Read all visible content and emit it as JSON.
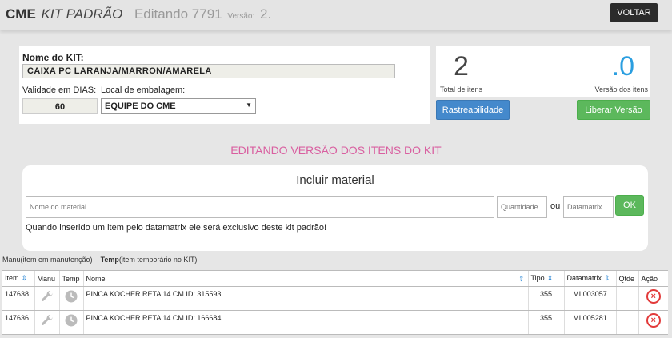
{
  "header": {
    "brand_cme": "CME",
    "brand_kit": "KIT PADRÃO",
    "editing_label": "Editando 7791",
    "version_label": "Versão:",
    "version_value": "2.",
    "back_button": "VOLTAR"
  },
  "kit": {
    "name_label": "Nome do KIT:",
    "name_value": "CAIXA PC LARANJA/MARRON/AMARELA",
    "validity_label": "Validade em DIAS:",
    "validity_value": "60",
    "location_label": "Local de embalagem:",
    "location_value": "EQUIPE DO CME"
  },
  "stats": {
    "total_items": "2",
    "total_items_label": "Total de itens",
    "version_items": ".0",
    "version_items_label": "Versão dos itens",
    "rastreabilidade_button": "Rastreabilidade",
    "liberar_button": "Liberar Versão"
  },
  "section_title": "EDITANDO VERSÃO DOS ITENS DO KIT",
  "incluir": {
    "title": "Incluir material",
    "material_placeholder": "Nome do material",
    "quantity_placeholder": "Quantidade",
    "ou_label": "ou",
    "datamatrix_placeholder": "Datamatrix",
    "ok_button": "OK",
    "note": "Quando inserido um item pelo datamatrix ele será exclusivo deste kit padrão!"
  },
  "legend": {
    "manu": "Manu(item em manutenção)",
    "temp_bold": "Temp",
    "temp_rest": "(item temporário no KIT)"
  },
  "table": {
    "headers": {
      "item": "Item",
      "manu": "Manu",
      "temp": "Temp",
      "nome": "Nome",
      "tipo": "Tipo",
      "datamatrix": "Datamatrix",
      "qtde": "Qtde",
      "acao": "Ação"
    },
    "rows": [
      {
        "item": "147638",
        "nome": "PINCA KOCHER RETA 14 CM ID: 315593",
        "tipo": "355",
        "datamatrix": "ML003057",
        "qtde": ""
      },
      {
        "item": "147636",
        "nome": "PINCA KOCHER RETA 14 CM ID: 166684",
        "tipo": "355",
        "datamatrix": "ML005281",
        "qtde": ""
      }
    ]
  },
  "icons": {
    "sort": "sort-arrows-icon",
    "manutencao": "wrench-icon",
    "temporario": "clock-icon",
    "remover": "remove-circle-icon"
  },
  "colors": {
    "accent_blue": "#2a9ee0",
    "section_title_pink": "#d95fa0",
    "button_blue": "#4489cc",
    "button_green": "#5cb85c",
    "delete_red": "#e23a3a"
  }
}
